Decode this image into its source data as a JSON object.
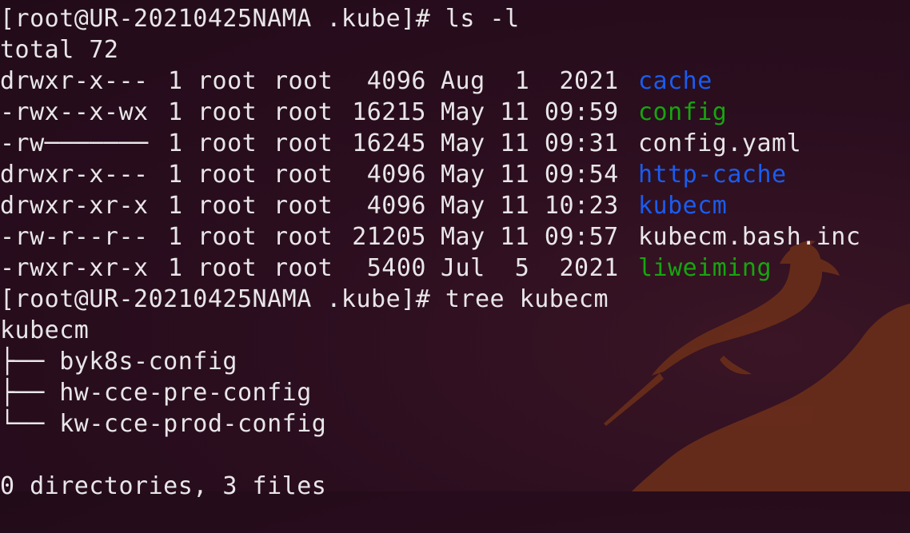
{
  "prompt": "[root@UR-20210425NAMA .kube]#",
  "commands": [
    "ls -l",
    "tree kubecm"
  ],
  "total": "total 72",
  "listing": [
    {
      "perm": "drwxr-x---",
      "links": "1",
      "owner": "root",
      "group": "root",
      "size": "4096",
      "date": "Aug  1  2021",
      "name": "cache",
      "color": "#1a5cf0"
    },
    {
      "perm": "-rwx--x-wx",
      "links": "1",
      "owner": "root",
      "group": "root",
      "size": "16215",
      "date": "May 11 09:59",
      "name": "config",
      "color": "#17a50f"
    },
    {
      "perm": "-rw───────",
      "links": "1",
      "owner": "root",
      "group": "root",
      "size": "16245",
      "date": "May 11 09:31",
      "name": "config.yaml",
      "color": "#e8e6e8"
    },
    {
      "perm": "drwxr-x---",
      "links": "1",
      "owner": "root",
      "group": "root",
      "size": "4096",
      "date": "May 11 09:54",
      "name": "http-cache",
      "color": "#1a5cf0"
    },
    {
      "perm": "drwxr-xr-x",
      "links": "1",
      "owner": "root",
      "group": "root",
      "size": "4096",
      "date": "May 11 10:23",
      "name": "kubecm",
      "color": "#1a5cf0"
    },
    {
      "perm": "-rw-r--r--",
      "links": "1",
      "owner": "root",
      "group": "root",
      "size": "21205",
      "date": "May 11 09:57",
      "name": "kubecm.bash.inc",
      "color": "#e8e6e8"
    },
    {
      "perm": "-rwxr-xr-x",
      "links": "1",
      "owner": "root",
      "group": "root",
      "size": "5400",
      "date": "Jul  5  2021",
      "name": "liweiming",
      "color": "#17a50f"
    }
  ],
  "tree": {
    "root": "kubecm",
    "items": [
      "├── byk8s-config",
      "├── hw-cce-pre-config",
      "└── kw-cce-prod-config"
    ],
    "summary": "0 directories, 3 files"
  },
  "colors": {
    "background": "#2a0f1f",
    "text": "#e8e6e8",
    "directory": "#1a5cf0",
    "executable": "#17a50f",
    "watermark": "#7a3520"
  },
  "icons": {
    "watermark": "narwhal-watermark-icon"
  }
}
